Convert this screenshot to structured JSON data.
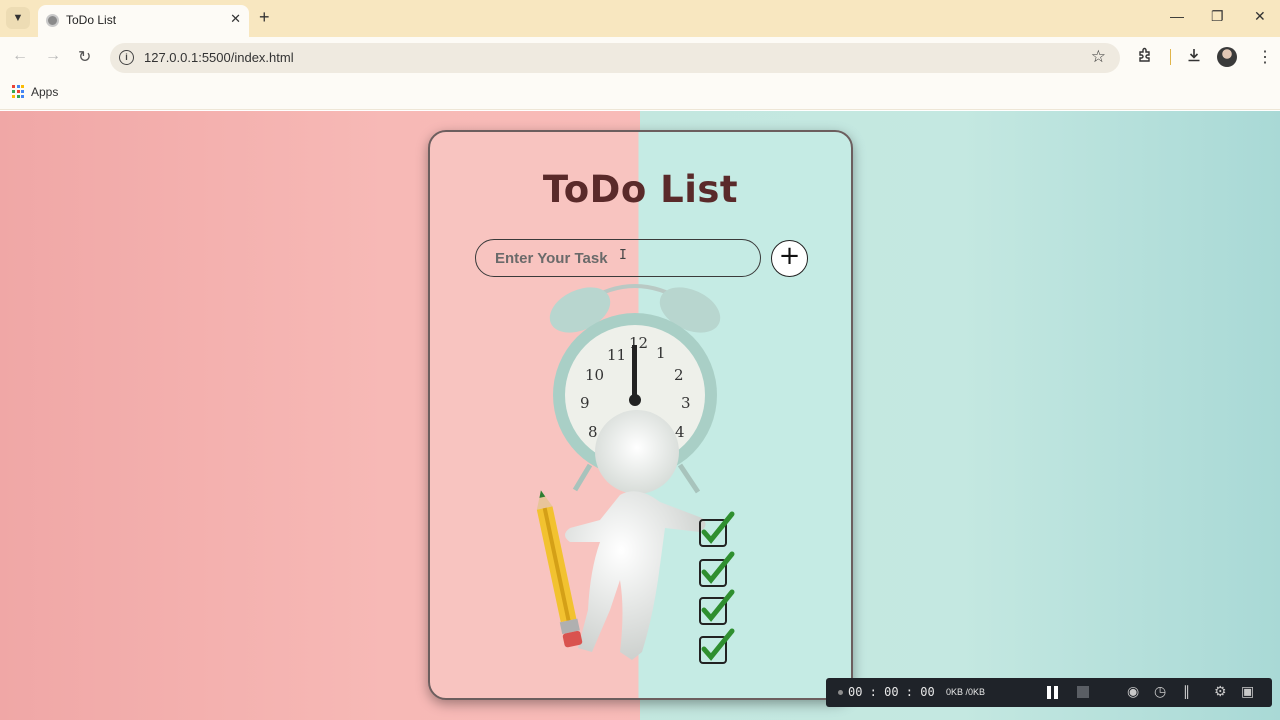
{
  "browser": {
    "tab_title": "ToDo List",
    "url": "127.0.0.1:5500/index.html",
    "bookmarks": [
      {
        "label": "Apps"
      }
    ]
  },
  "page": {
    "title": "ToDo List",
    "task_input": {
      "placeholder": "Enter Your Task",
      "value": ""
    },
    "add_button_label": "+"
  },
  "recorder": {
    "timer": "00 : 00 : 00",
    "data_size": "0KB /0KB"
  },
  "icons": {
    "tab_menu": "chevron-down-icon",
    "favicon": "globe-icon",
    "back": "arrow-left-icon",
    "forward": "arrow-right-icon",
    "reload": "reload-icon",
    "site_info": "info-icon",
    "bookmark": "star-icon",
    "extensions": "puzzle-icon",
    "downloads": "download-icon",
    "menu": "kebab-icon",
    "illustration": "alarm-clock-figure-pencil-checkmarks"
  },
  "colors": {
    "title": "#5a2a2a",
    "bg_left": "#f8bbb8",
    "bg_right": "#c4e8e1"
  }
}
